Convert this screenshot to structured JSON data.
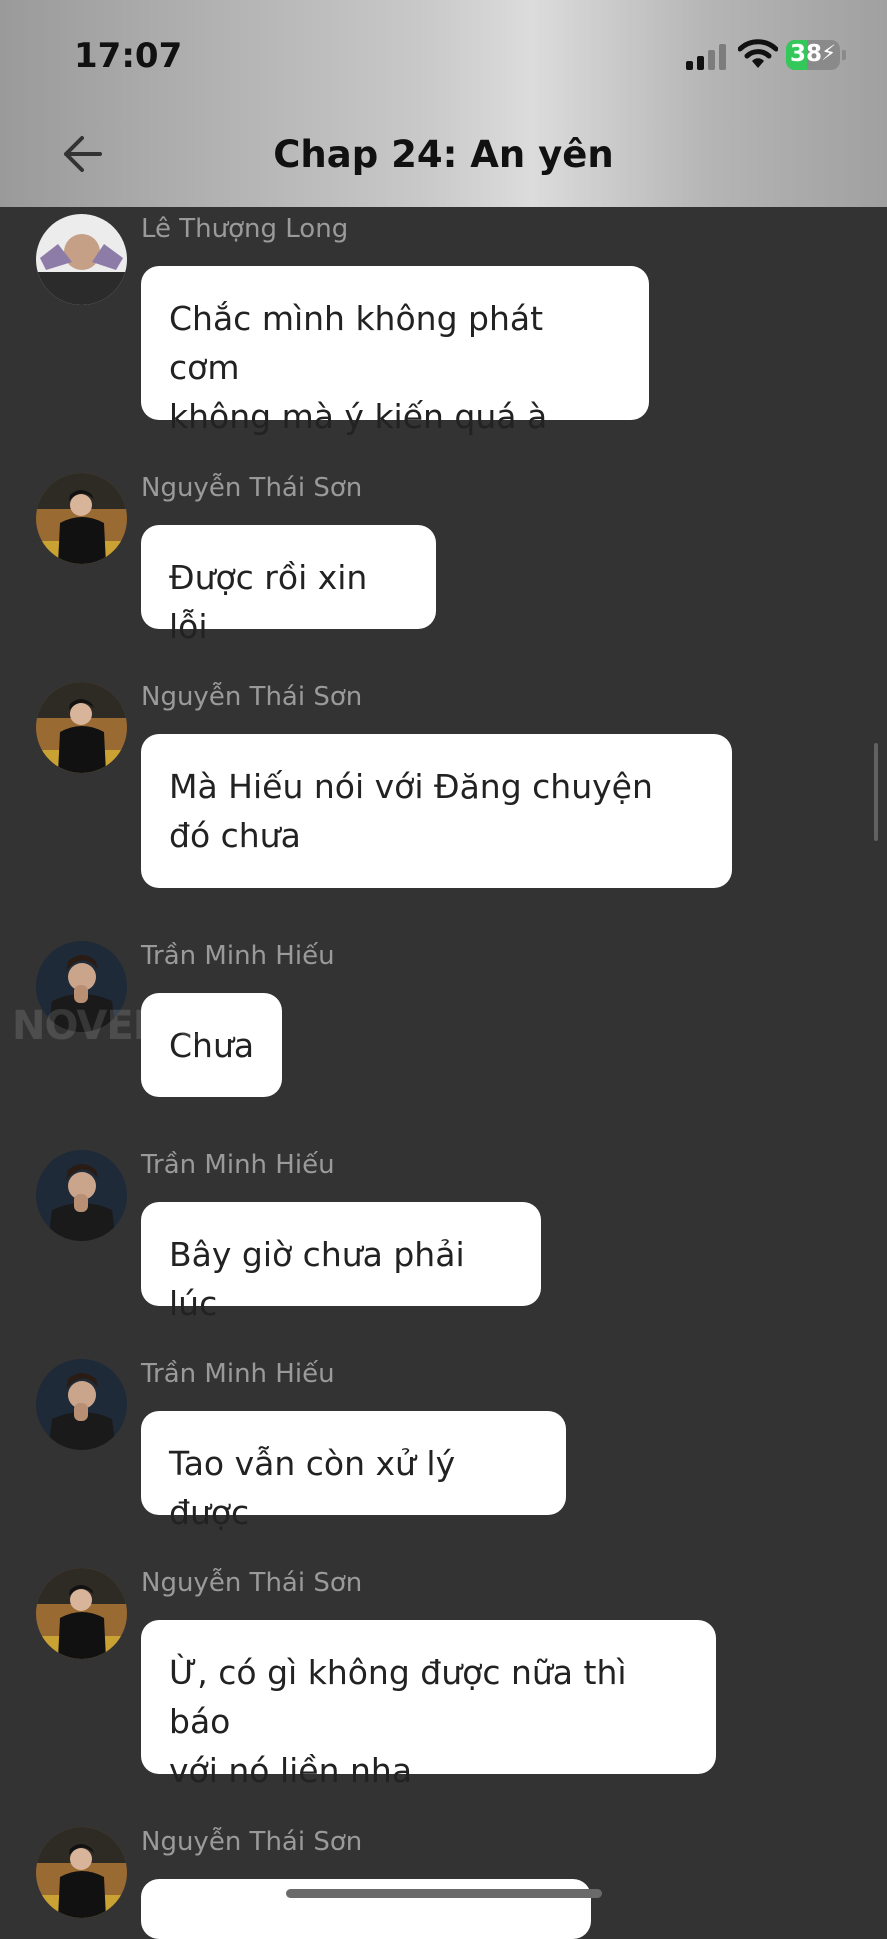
{
  "status_bar": {
    "time": "17:07",
    "battery_level": "38",
    "battery_charging": true
  },
  "header": {
    "title": "Chap 24: An yên"
  },
  "messages": [
    {
      "sender": "Lê Thượng Long",
      "text": "Chắc mình không phát cơm\nkhông mà ý kiến quá à"
    },
    {
      "sender": "Nguyễn Thái Sơn",
      "text": "Được rồi xin lỗi"
    },
    {
      "sender": "Nguyễn Thái Sơn",
      "text": "Mà Hiếu nói với Đăng chuyện\nđó chưa"
    },
    {
      "sender": "Trần Minh Hiếu",
      "text": "Chưa"
    },
    {
      "sender": "Trần Minh Hiếu",
      "text": "Bây giờ chưa phải lúc"
    },
    {
      "sender": "Trần Minh Hiếu",
      "text": "Tao vẫn còn xử lý được"
    },
    {
      "sender": "Nguyễn Thái Sơn",
      "text": "Ừ, có gì không được nữa thì báo\nvới nó liền nha"
    },
    {
      "sender": "Nguyễn Thái Sơn",
      "text": ""
    }
  ],
  "watermark": "NOVELTOON",
  "colors": {
    "background": "#333333",
    "bubble": "#ffffff",
    "sender_name": "#9a9a9a",
    "battery_fill": "#34c759"
  }
}
